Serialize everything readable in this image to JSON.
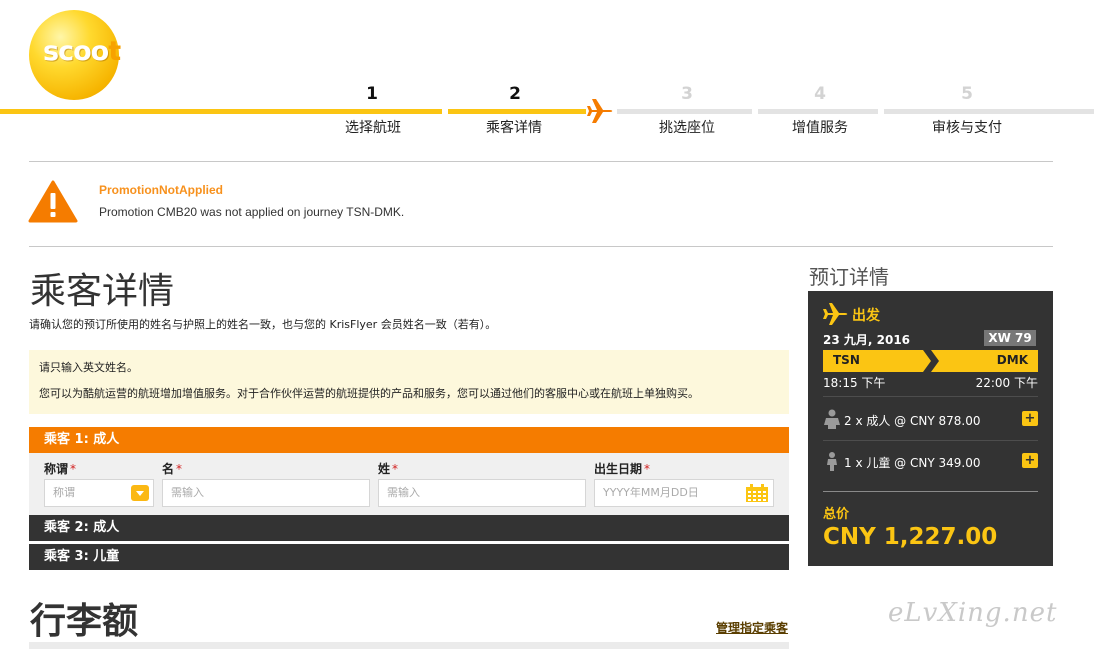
{
  "logo": {
    "text_main": "scoo",
    "text_accent": "t"
  },
  "progress": {
    "steps": [
      {
        "num": "1",
        "label": "选择航班"
      },
      {
        "num": "2",
        "label": "乘客详情"
      },
      {
        "num": "3",
        "label": "挑选座位"
      },
      {
        "num": "4",
        "label": "增值服务"
      },
      {
        "num": "5",
        "label": "审核与支付"
      }
    ],
    "current_step": 2
  },
  "alert": {
    "title": "PromotionNotApplied",
    "message": "Promotion CMB20 was not applied on journey TSN-DMK."
  },
  "main": {
    "title": "乘客详情",
    "subtitle": "请确认您的预订所使用的姓名与护照上的姓名一致，也与您的 KrisFlyer 会员姓名一致（若有）。",
    "notice_1": "请只输入英文姓名。",
    "notice_2": "您可以为酷航运营的航班增加增值服务。对于合作伙伴运营的航班提供的产品和服务，您可以通过他们的客服中心或在航班上单独购买。",
    "passengers": [
      {
        "heading": "乘客 1: 成人"
      },
      {
        "heading": "乘客 2: 成人"
      },
      {
        "heading": "乘客 3: 儿童"
      }
    ],
    "form": {
      "title_label": "称谓",
      "title_placeholder": "称谓",
      "first_label": "名",
      "first_placeholder": "需输入",
      "last_label": "姓",
      "last_placeholder": "需输入",
      "dob_label": "出生日期",
      "dob_placeholder": "YYYY年MM月DD日",
      "required_mark": "*"
    },
    "baggage_title": "行李额",
    "manage_link": "管理指定乘客"
  },
  "sidebar": {
    "title": "预订详情",
    "departure_label": "出发",
    "date": "23 九月, 2016",
    "flight_no": "XW 79",
    "from": "TSN",
    "to": "DMK",
    "dep_time": "18:15 下午",
    "arr_time": "22:00 下午",
    "adults": "2 x 成人 @ CNY 878.00",
    "children": "1 x 儿童 @ CNY 349.00",
    "plus": "+",
    "total_label": "总价",
    "total_value": "CNY 1,227.00"
  },
  "watermark": "eLvXing.net",
  "colors": {
    "brand_yellow": "#fbc513",
    "orange": "#f57c00",
    "dark": "#333333"
  }
}
